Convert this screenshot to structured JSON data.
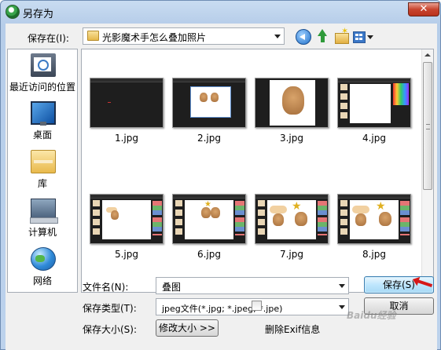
{
  "window": {
    "title": "另存为",
    "close_label": "✕"
  },
  "toolbar": {
    "save_in_label": "保存在(I):",
    "current_folder": "光影魔术手怎么叠加照片"
  },
  "places": [
    {
      "label": "最近访问的位置",
      "icon": "recent-places-icon"
    },
    {
      "label": "桌面",
      "icon": "desktop-icon"
    },
    {
      "label": "库",
      "icon": "library-icon"
    },
    {
      "label": "计算机",
      "icon": "computer-icon"
    },
    {
      "label": "网络",
      "icon": "network-icon"
    }
  ],
  "files": [
    {
      "name": "1.jpg"
    },
    {
      "name": "2.jpg"
    },
    {
      "name": "3.jpg"
    },
    {
      "name": "4.jpg"
    },
    {
      "name": "5.jpg"
    },
    {
      "name": "6.jpg"
    },
    {
      "name": "7.jpg"
    },
    {
      "name": "8.jpg"
    }
  ],
  "form": {
    "filename_label": "文件名(N):",
    "filename_value": "叠图",
    "filetype_label": "保存类型(T):",
    "filetype_value": "jpeg文件(*.jpg; *.jpeg; *.jpe)",
    "savesize_label": "保存大小(S):",
    "resize_button": "修改大小 >>",
    "exif_checkbox_label": "删除Exif信息",
    "save_button": "保存(S)",
    "cancel_button": "取消"
  },
  "watermark": "Baidu经验",
  "colors": {
    "accent": "#3c7fb1",
    "title_bar": "#c9dcf1",
    "close_button": "#c8442e",
    "annotation_arrow": "#d61818"
  }
}
